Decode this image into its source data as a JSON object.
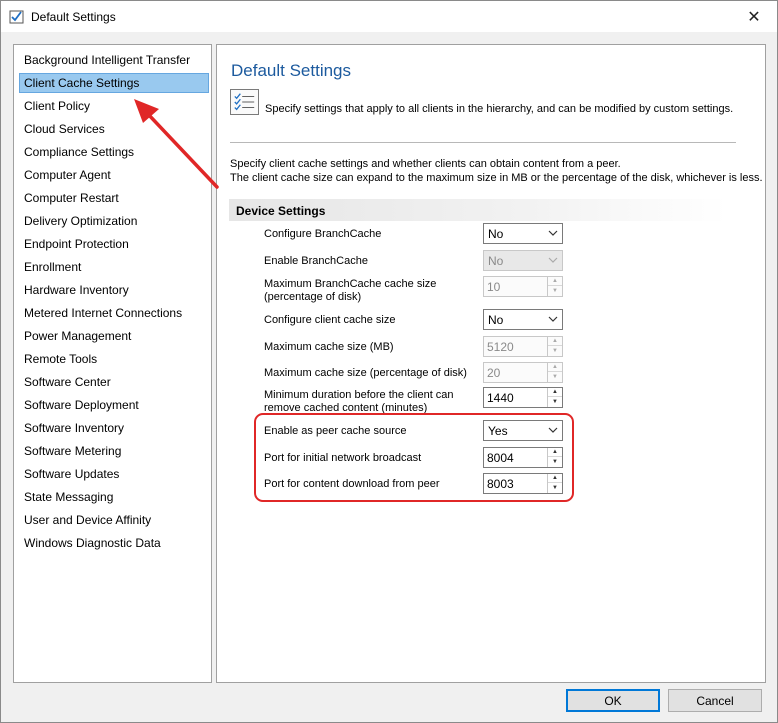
{
  "window": {
    "title": "Default Settings"
  },
  "nav": {
    "items": [
      "Background Intelligent Transfer",
      "Client Cache Settings",
      "Client Policy",
      "Cloud Services",
      "Compliance Settings",
      "Computer Agent",
      "Computer Restart",
      "Delivery Optimization",
      "Endpoint Protection",
      "Enrollment",
      "Hardware Inventory",
      "Metered Internet Connections",
      "Power Management",
      "Remote Tools",
      "Software Center",
      "Software Deployment",
      "Software Inventory",
      "Software Metering",
      "Software Updates",
      "State Messaging",
      "User and Device Affinity",
      "Windows Diagnostic Data"
    ],
    "selected": "Client Cache Settings"
  },
  "page": {
    "title": "Default Settings",
    "description": "Specify settings that apply to all clients in the hierarchy, and can be modified by custom settings.",
    "intro_line1": "Specify client cache settings and whether clients can obtain content from a peer.",
    "intro_line2": "The client cache size can expand to the maximum size in MB or the percentage of the disk, whichever is less."
  },
  "group": {
    "title": "Device Settings",
    "settings": [
      {
        "label": "Configure BranchCache",
        "value": "No"
      },
      {
        "label": "Enable BranchCache",
        "value": "No"
      },
      {
        "label_line1": "Maximum BranchCache cache size",
        "label_line2": "(percentage of disk)",
        "value": "10"
      },
      {
        "label": "Configure client cache size",
        "value": "No"
      },
      {
        "label": "Maximum cache size (MB)",
        "value": "5120"
      },
      {
        "label": "Maximum cache size (percentage of disk)",
        "value": "20"
      },
      {
        "label_line1": "Minimum duration before the client can",
        "label_line2": "remove cached content (minutes)",
        "value": "1440"
      },
      {
        "label": "Enable as peer cache source",
        "value": "Yes"
      },
      {
        "label": "Port for initial network broadcast",
        "value": "8004"
      },
      {
        "label": "Port for content download from peer",
        "value": "8003"
      }
    ]
  },
  "buttons": {
    "ok": "OK",
    "cancel": "Cancel"
  },
  "colors": {
    "accent": "#1c5a9e",
    "selection": "#99c9ef",
    "annotation": "#e02727"
  }
}
